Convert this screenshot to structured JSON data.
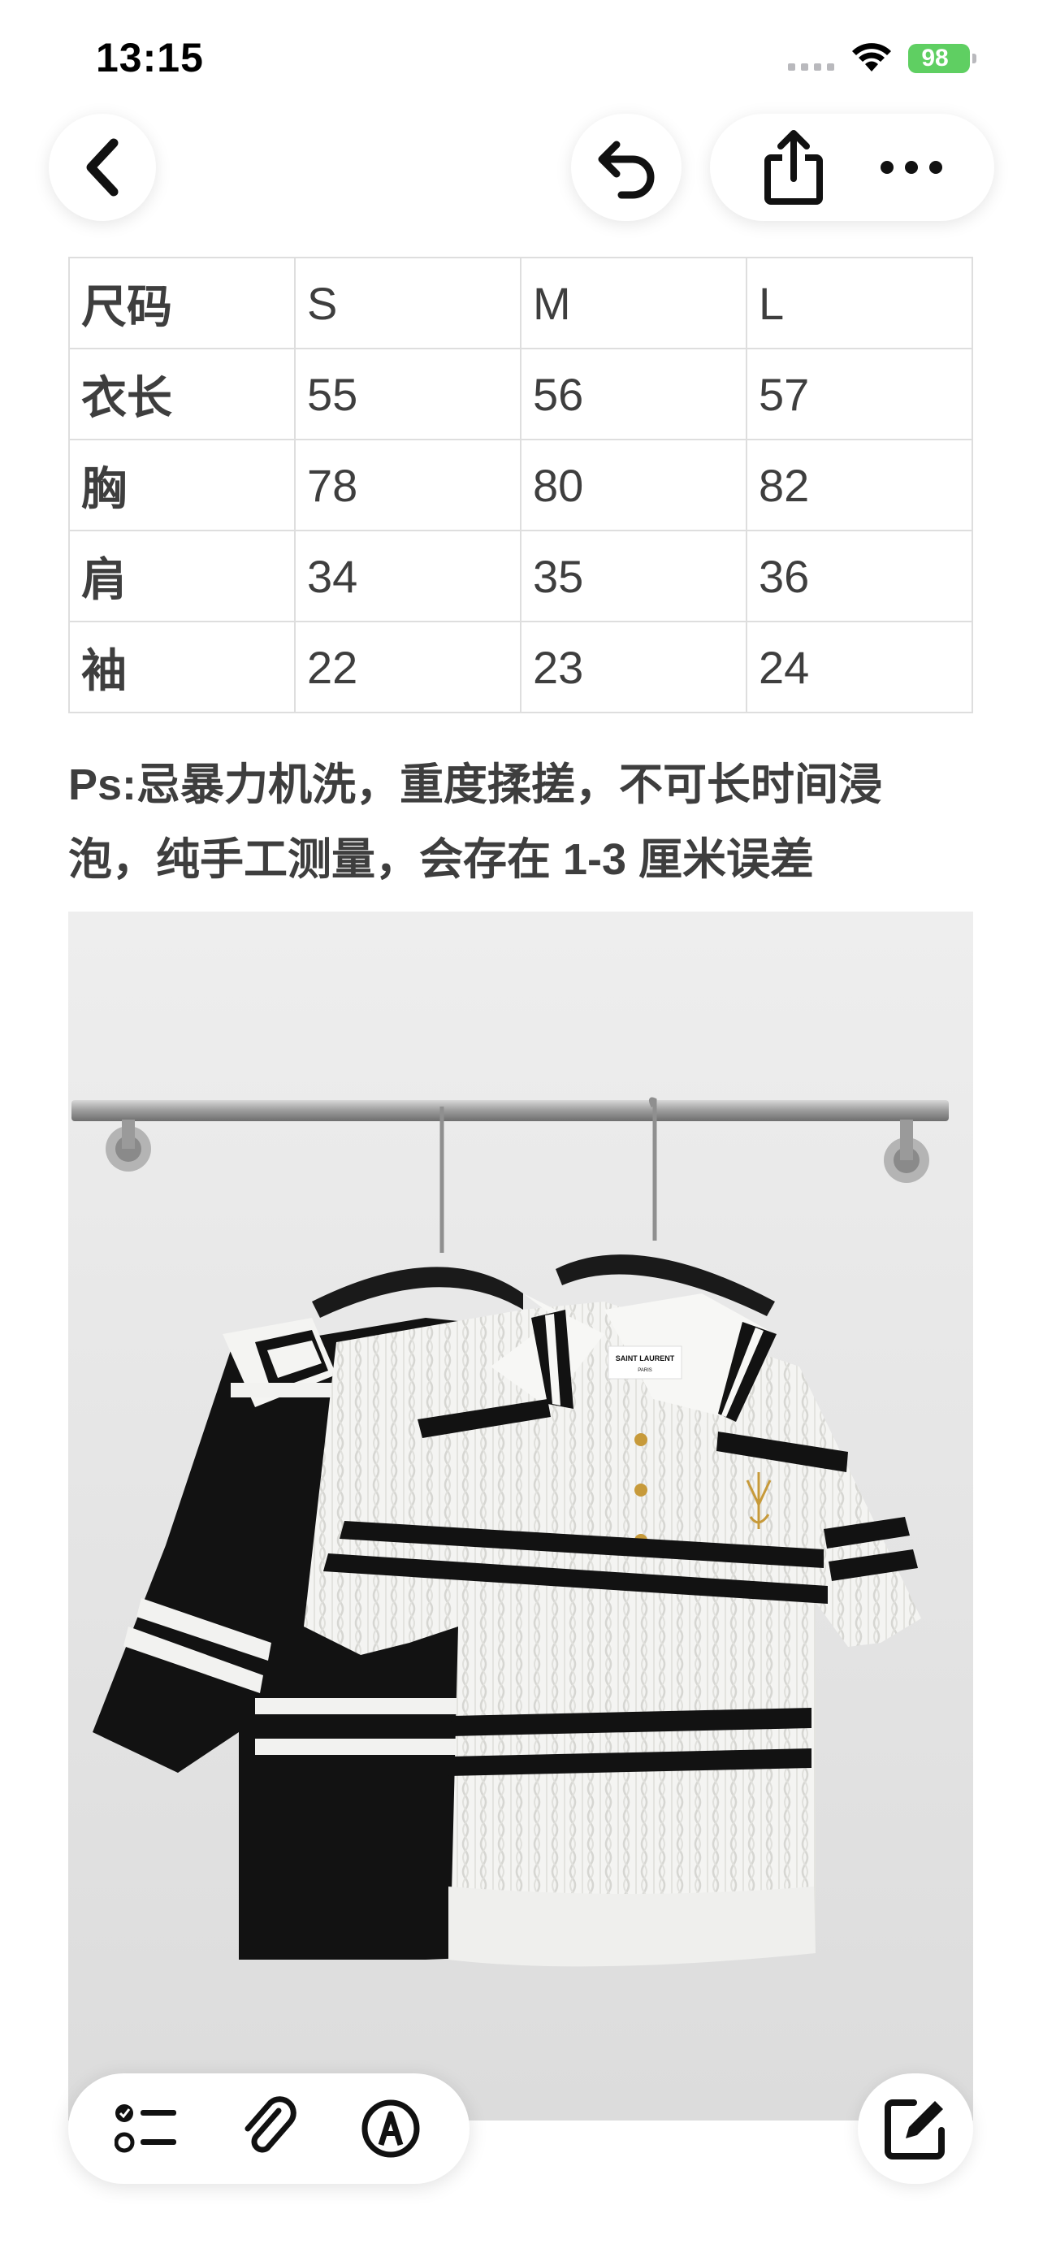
{
  "status": {
    "time": "13:15",
    "battery": "98"
  },
  "nav": {
    "back_icon": "chevron-left-icon",
    "undo_icon": "undo-icon",
    "share_icon": "share-icon",
    "more_icon": "more-icon"
  },
  "size_table": {
    "rows": [
      [
        "尺码",
        "S",
        "M",
        "L"
      ],
      [
        "衣长",
        "55",
        "56",
        "57"
      ],
      [
        "胸",
        "78",
        "80",
        "82"
      ],
      [
        "肩",
        "34",
        "35",
        "36"
      ],
      [
        "袖",
        "22",
        "23",
        "24"
      ]
    ]
  },
  "note": {
    "line1": "Ps:忌暴力机洗，重度揉搓，不可长时间浸",
    "line2": "泡，纯手工测量，会存在 1-3 厘米误差"
  },
  "photo": {
    "label_brand": "SAINT LAURENT",
    "label_city": "PARIS",
    "colors": {
      "wall": "#e6e6e6",
      "knit_white": "#f4f4f2",
      "knit_black": "#121212"
    }
  },
  "toolbar": {
    "checklist_icon": "checklist-icon",
    "attach_icon": "paperclip-icon",
    "markup_icon": "markup-pen-icon",
    "compose_icon": "compose-icon"
  }
}
